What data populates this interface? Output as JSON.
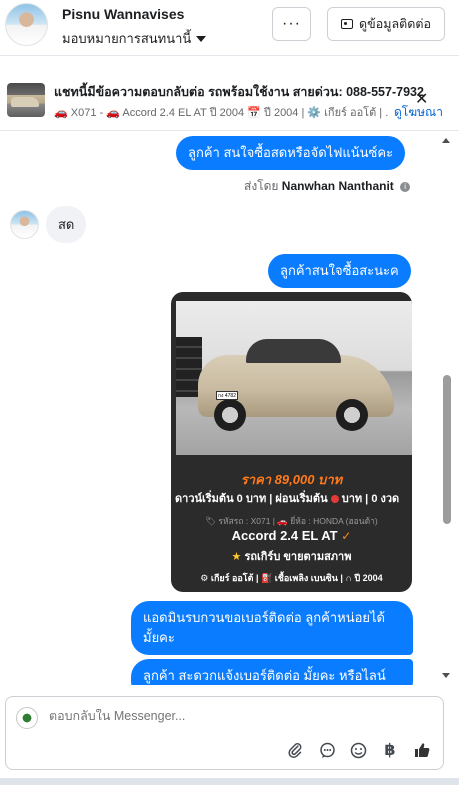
{
  "header": {
    "name": "Pisnu Wannavises",
    "assign_label": "มอบหมายการสนทนานี้",
    "more_label": "···",
    "contact_label": "ดูข้อมูลติดต่อ"
  },
  "ad": {
    "title": "แชทนี้มีข้อความตอบกลับต่อ รถพร้อมใช้งาน สายด่วน: 088-557-7932",
    "subtitle": "🚗 X071 - 🚗 Accord 2.4 EL AT ปี 2004 📅 ปี 2004 | ⚙️ เกียร์ ออโต้ | ...",
    "link_label": "ดูโฆษณา",
    "close_label": "✕"
  },
  "messages": [
    {
      "direction": "out",
      "text": "ลูกค้า สนใจซื้อสดหรือจัดไฟแน้นซ์คะ"
    },
    {
      "direction": "in",
      "text": "สด"
    },
    {
      "direction": "out",
      "text": "ลูกค้าสนใจซื้อสะนะค"
    },
    {
      "direction": "out",
      "text": "แอดมินรบกวนขอเบอร์ติดต่อ ลูกค้าหน่อยได้มั้ยคะ"
    },
    {
      "direction": "out",
      "text": "ลูกค้า สะดวกแจ้งเบอร์ติดต่อ มั้ยคะ หรือไลน์"
    }
  ],
  "sent_by": {
    "prefix": "ส่งโดย",
    "name": "Nanwhan Nanthanit",
    "info_icon": "i"
  },
  "car_card": {
    "price": "ราคา 89,000 บาท",
    "down_prefix": "ดาวน์เริ่มต้น 0 บาท | ผ่อนเริ่มต้น",
    "down_suffix": "บาท | 0 งวด",
    "code_line": "🏷 รหัสรถ : X071 | 🚗 ยี่ห้อ : HONDA (ฮอนด้า)",
    "model": "Accord 2.4 EL AT",
    "model_check": "✓",
    "condition_star": "★",
    "condition": "รถเกิร์บ ขายตามสภาพ",
    "specs": "⚙ เกียร์ ออโต้  |  ⛽ เชื้อเพลิง เบนซิน  |  ∩ ปี 2004",
    "plate": "กง 4782"
  },
  "composer": {
    "placeholder": "ตอบกลับใน Messenger...",
    "icons": [
      "paperclip-icon",
      "speech-bubble-icon",
      "emoji-icon",
      "baht-icon",
      "thumbs-up-icon"
    ],
    "baht_glyph": "฿",
    "thumbs_glyph": "👍"
  },
  "colors": {
    "accent": "#0a7cff",
    "link": "#0064d1",
    "card_bg": "#2b2b2b",
    "price": "#ff7a1a"
  }
}
